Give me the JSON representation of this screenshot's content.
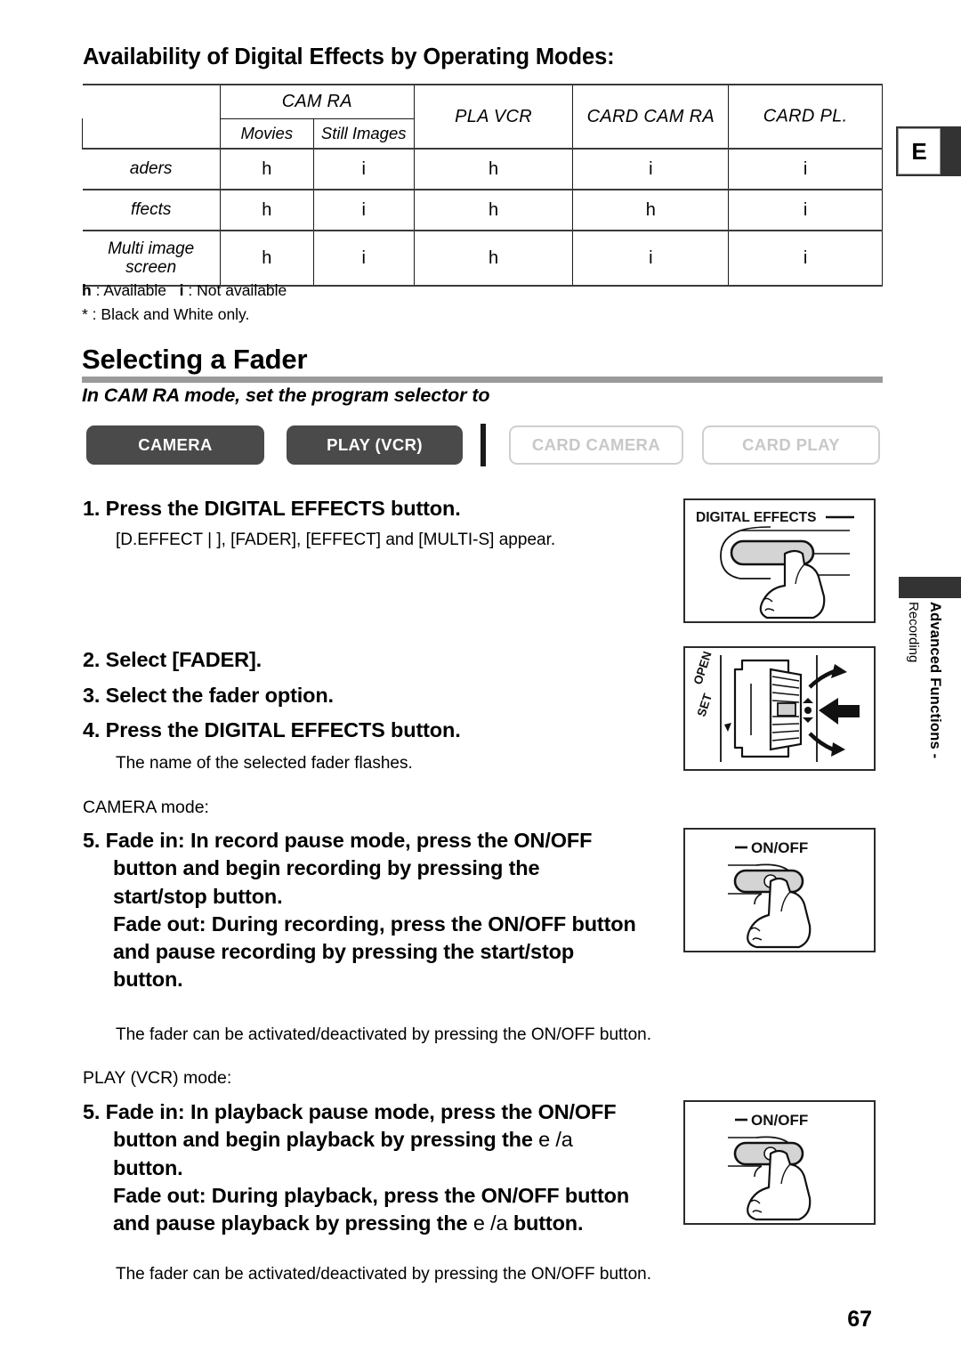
{
  "edge": {
    "language_letter": "E",
    "side_label_main": "Advanced Functions -",
    "side_label_sub": "Recording"
  },
  "section_title": "Availability of Digital Effects by Operating Modes:",
  "table": {
    "group_header": "CAM  RA",
    "sub_headers": [
      "Movies",
      "Still Images"
    ],
    "col_headers": [
      "PLA    VCR",
      "CARD CAM  RA",
      "CARD PL."
    ],
    "rows": [
      {
        "label": "aders",
        "cells": [
          "h",
          "i",
          "h",
          "i",
          "i"
        ]
      },
      {
        "label": "ffects",
        "cells": [
          "h",
          "i",
          "h",
          "h",
          "i"
        ]
      },
      {
        "label": "Multi image\nscreen",
        "cells": [
          "h",
          "i",
          "h",
          "i",
          "i"
        ]
      }
    ],
    "legend_line1_sym_a": "h",
    "legend_line1_txt_a": ": Available",
    "legend_line1_sym_b": "i",
    "legend_line1_txt_b": ": Not available",
    "legend_line2": "* : Black and White only."
  },
  "fader": {
    "heading": "Selecting a Fader",
    "subheading": "In CAM  RA mode, set the program selector to",
    "modes": [
      {
        "label": "CAMERA",
        "active": true
      },
      {
        "label": "PLAY (VCR)",
        "active": true
      },
      {
        "label": "CARD CAMERA",
        "active": false
      },
      {
        "label": "CARD PLAY",
        "active": false
      }
    ]
  },
  "steps": {
    "step1": "1. Press the DIGITAL EFFECTS button.",
    "step1_note": "[D.EFFECT |    ], [FADER], [EFFECT] and [MULTI-S] appear.",
    "step2": "2. Select [FADER].",
    "step3": "3. Select the fader option.",
    "step4": "4. Press the DIGITAL EFFECTS button.",
    "step4_note": "The name of the selected fader flashes.",
    "camera_mode_label": "CAMERA mode:",
    "camera_step5_line1": "5. Fade in: In record pause mode, press the ON/OFF",
    "camera_step5_line2": "button and begin recording by pressing the",
    "camera_step5_line3": "start/stop button.",
    "camera_step5_line4": "Fade out: During recording, press the ON/OFF button",
    "camera_step5_line5": "and pause recording by pressing the start/stop",
    "camera_step5_line6": "button.",
    "camera_note": "The fader can be activated/deactivated by pressing the ON/OFF button.",
    "play_mode_label": "PLAY (VCR) mode:",
    "play_step5_line1": "5. Fade in: In playback pause mode, press the ON/OFF",
    "play_step5_line2a": "button and begin playback by pressing the ",
    "play_step5_line2b": "e /a",
    "play_step5_line3": "button.",
    "play_step5_line4": "Fade out: During playback, press the ON/OFF button",
    "play_step5_line5a": "and pause playback by pressing the ",
    "play_step5_line5b": "e /a",
    "play_step5_line5c": " button.",
    "play_note": "The fader can be activated/deactivated by pressing the ON/OFF button."
  },
  "illustrations": {
    "digital_effects_label": "DIGITAL EFFECTS",
    "dial_labels": [
      "OPEN",
      "SET"
    ],
    "onoff_label": "ON/OFF"
  },
  "page_number": "67"
}
